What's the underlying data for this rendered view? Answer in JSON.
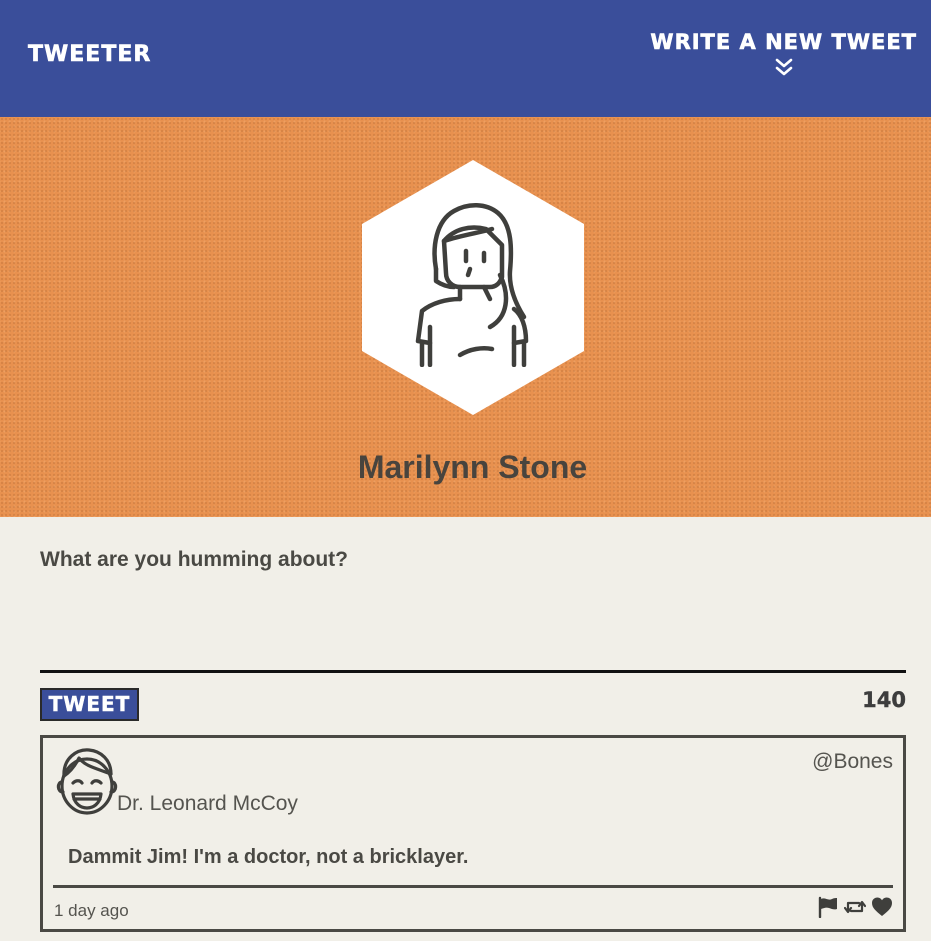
{
  "nav": {
    "brand": "TWEETER",
    "compose_toggle_label": "WRITE A NEW TWEET"
  },
  "profile": {
    "name": "Marilynn Stone"
  },
  "compose": {
    "prompt": "What are you humming about?",
    "tweet_button_label": "TWEET",
    "char_counter": "140"
  },
  "tweets": [
    {
      "author_name": "Dr. Leonard McCoy",
      "handle": "@Bones",
      "content": "Dammit Jim! I'm a doctor, not a bricklayer.",
      "time_ago": "1 day ago"
    }
  ],
  "colors": {
    "nav_bg": "#3a4e9a",
    "profile_bg": "#e8914f",
    "page_bg": "#f1efe8",
    "text": "#4a4944"
  },
  "icons": {
    "compose_toggle": "double-chevron-down-icon",
    "flag": "flag-icon",
    "retweet": "retweet-icon",
    "like": "heart-icon"
  }
}
